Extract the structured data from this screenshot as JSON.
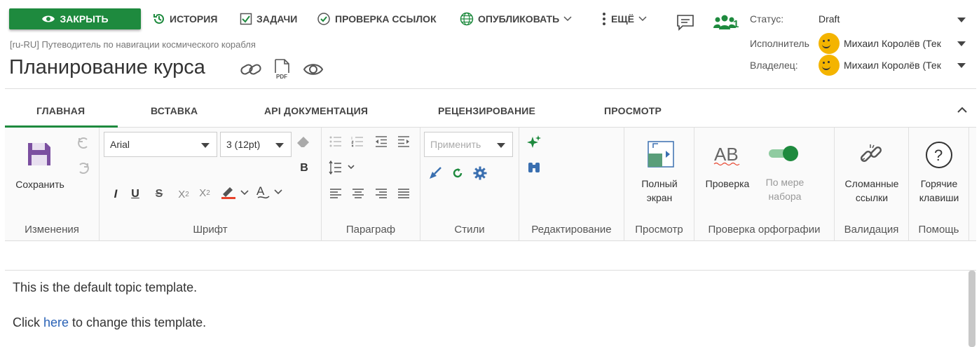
{
  "toolbar": {
    "close_label": "ЗАКРЫТЬ",
    "history_label": "ИСТОРИЯ",
    "tasks_label": "ЗАДАЧИ",
    "link_check_label": "ПРОВЕРКА ССЫЛОК",
    "publish_label": "ОПУБЛИКОВАТЬ",
    "more_label": "ЕЩЁ",
    "users_count": "1"
  },
  "breadcrumb": "[ru-RU] Путеводитель по навигации космического корабля",
  "page_title": "Планирование курса",
  "meta": {
    "status_label": "Статус:",
    "status_value": "Draft",
    "assignee_label": "Исполнитель",
    "assignee_value": "Михаил Королёв (Тек",
    "owner_label": "Владелец:",
    "owner_value": "Михаил Королёв (Тек"
  },
  "tabs": [
    "ГЛАВНАЯ",
    "ВСТАВКА",
    "API ДОКУМЕНТАЦИЯ",
    "РЕЦЕНЗИРОВАНИЕ",
    "ПРОСМОТР"
  ],
  "ribbon": {
    "save_label": "Сохранить",
    "group_changes": "Изменения",
    "font_name": "Arial",
    "font_size": "3 (12pt)",
    "group_font": "Шрифт",
    "group_paragraph": "Параграф",
    "style_placeholder": "Применить",
    "group_styles": "Стили",
    "group_editing": "Редактирование",
    "fullscreen_line1": "Полный",
    "fullscreen_line2": "экран",
    "group_view": "Просмотр",
    "spellcheck_label": "Проверка",
    "as_you_type_line1": "По мере",
    "as_you_type_line2": "набора",
    "group_spelling": "Проверка орфографии",
    "broken_links_line1": "Сломанные",
    "broken_links_line2": "ссылки",
    "group_validation": "Валидация",
    "hotkeys_line1": "Горячие",
    "hotkeys_line2": "клавиши",
    "group_help": "Помощь"
  },
  "editor": {
    "line1": "This is the default topic template.",
    "line2_prefix": "Click ",
    "line2_link": "here",
    "line2_suffix": " to change this template."
  },
  "colors": {
    "brand_green": "#1e8a3e",
    "link_blue": "#2a62b6",
    "save_purple": "#7b4fa0"
  }
}
